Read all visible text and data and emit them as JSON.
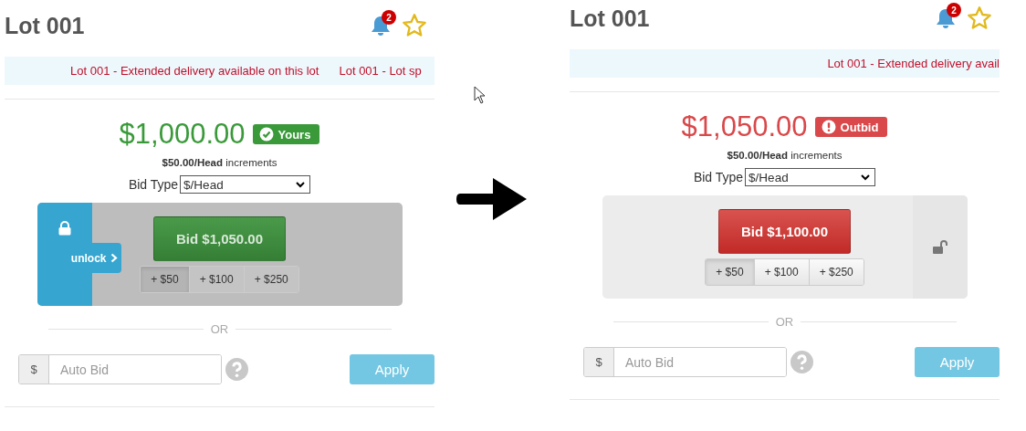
{
  "panels": [
    {
      "title": "Lot 001",
      "notification_count": "2",
      "ticker": [
        "Lot 001 - Extended delivery available on this lot",
        "Lot 001 - Lot sp"
      ],
      "price": "$1,000.00",
      "status": {
        "kind": "yours",
        "label": "Yours"
      },
      "increment_note": "**$50.00/Head** increments",
      "bid_type_label": "Bid Type",
      "bid_type": "$/Head",
      "locked": true,
      "unlock_label": "unlock",
      "bid_button": "Bid $1,050.00",
      "increments": [
        {
          "label": "+ $50",
          "selected": true
        },
        {
          "label": "+ $100",
          "selected": false
        },
        {
          "label": "+ $250",
          "selected": false
        }
      ],
      "or_label": "OR",
      "currency": "$",
      "auto_bid_placeholder": "Auto Bid",
      "apply": "Apply"
    },
    {
      "title": "Lot 001",
      "notification_count": "2",
      "ticker": [
        "Lot 001 - Extended delivery avail"
      ],
      "price": "$1,050.00",
      "status": {
        "kind": "outbid",
        "label": "Outbid"
      },
      "increment_note": "**$50.00/Head** increments",
      "bid_type_label": "Bid Type",
      "bid_type": "$/Head",
      "locked": false,
      "bid_button": "Bid $1,100.00",
      "increments": [
        {
          "label": "+ $50",
          "selected": true
        },
        {
          "label": "+ $100",
          "selected": false
        },
        {
          "label": "+ $250",
          "selected": false
        }
      ],
      "or_label": "OR",
      "currency": "$",
      "auto_bid_placeholder": "Auto Bid",
      "apply": "Apply"
    }
  ]
}
